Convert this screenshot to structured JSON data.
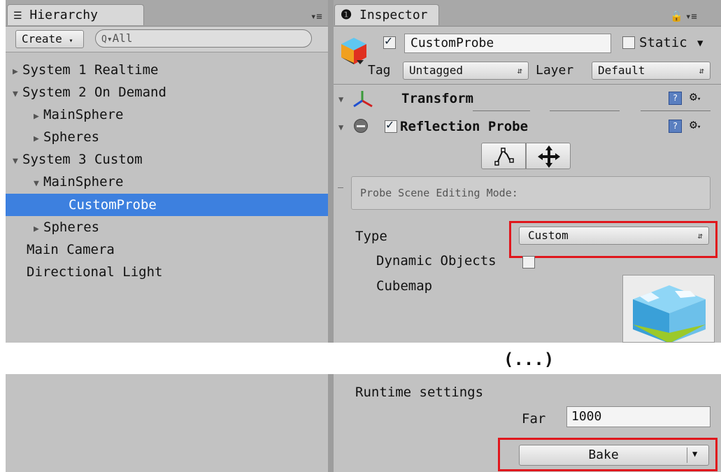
{
  "hierarchy": {
    "tab_label": "Hierarchy",
    "create_label": "Create",
    "search_placeholder": "All",
    "items": [
      {
        "label": "System 1 Realtime",
        "state": "collapsed"
      },
      {
        "label": "System 2 On Demand",
        "state": "expanded"
      },
      {
        "label": "MainSphere",
        "state": "collapsed"
      },
      {
        "label": "Spheres",
        "state": "collapsed"
      },
      {
        "label": "System 3 Custom",
        "state": "expanded"
      },
      {
        "label": "MainSphere",
        "state": "expanded"
      },
      {
        "label": "CustomProbe",
        "state": "selected"
      },
      {
        "label": "Spheres",
        "state": "collapsed"
      },
      {
        "label": "Main Camera",
        "state": "leaf"
      },
      {
        "label": "Directional Light",
        "state": "leaf"
      }
    ]
  },
  "inspector": {
    "tab_label": "Inspector",
    "object_name": "CustomProbe",
    "static_label": "Static",
    "tag_label": "Tag",
    "tag_value": "Untagged",
    "layer_label": "Layer",
    "layer_value": "Default",
    "transform_label": "Transform",
    "reflection_probe_label": "Reflection Probe",
    "edit_mode_text": "Probe Scene Editing Mode:",
    "type_label": "Type",
    "type_value": "Custom",
    "dynamic_objects_label": "Dynamic Objects",
    "cubemap_label": "Cubemap",
    "ellipsis": "(...)",
    "runtime_settings_label": "Runtime settings",
    "far_label": "Far",
    "far_value": "1000",
    "bake_label": "Bake"
  },
  "colors": {
    "selection": "#3d80df",
    "highlight_box": "#e0171d",
    "panel": "#c2c2c2"
  }
}
